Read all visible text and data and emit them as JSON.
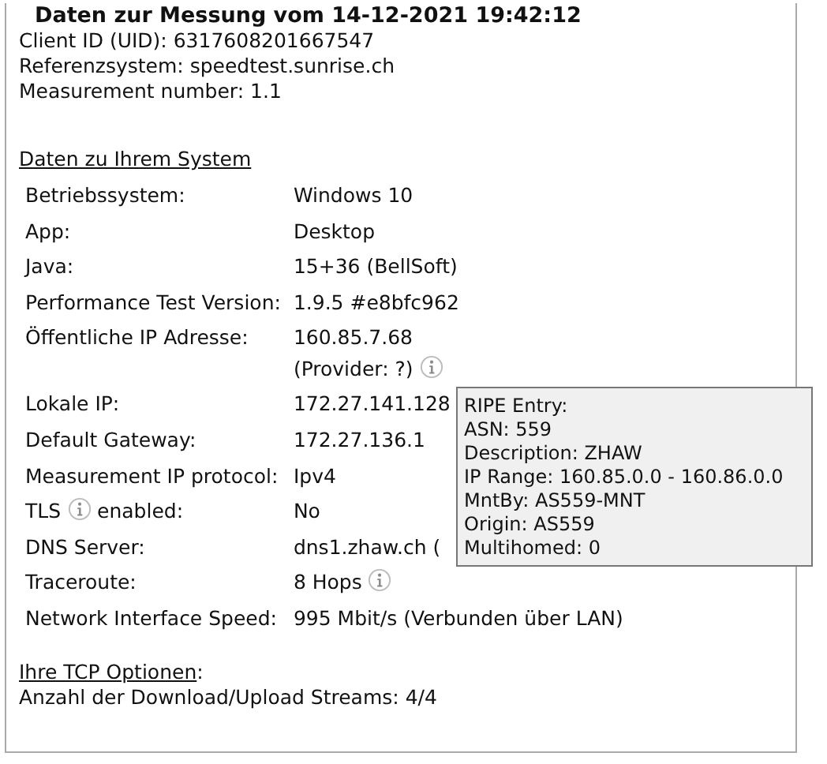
{
  "legend": "Daten zur Messung vom 14-12-2021 19:42:12",
  "header_lines": [
    "Client ID (UID): 6317608201667547",
    "Referenzsystem: speedtest.sunrise.ch",
    "Measurement number: 1.1"
  ],
  "system": {
    "heading": "Daten zu Ihrem System",
    "rows": [
      {
        "label": "Betriebssystem:",
        "label_info": false,
        "values": [
          "Windows 10"
        ],
        "value_info": false
      },
      {
        "label": "App:",
        "label_info": false,
        "values": [
          "Desktop"
        ],
        "value_info": false
      },
      {
        "label": "Java:",
        "label_info": false,
        "values": [
          "15+36 (BellSoft)"
        ],
        "value_info": false
      },
      {
        "label": "Performance Test Version:",
        "label_info": false,
        "values": [
          "1.9.5 #e8bfc962"
        ],
        "value_info": false
      },
      {
        "label": "Öffentliche IP Adresse:",
        "label_info": false,
        "values": [
          "160.85.7.68",
          "(Provider: ?)"
        ],
        "value_info": true
      },
      {
        "label": "Lokale IP:",
        "label_info": false,
        "values": [
          "172.27.141.128"
        ],
        "value_info": false
      },
      {
        "label": "Default Gateway:",
        "label_info": false,
        "values": [
          "172.27.136.1"
        ],
        "value_info": false
      },
      {
        "label": "Measurement IP protocol:",
        "label_info": false,
        "values": [
          "Ipv4"
        ],
        "value_info": false
      },
      {
        "label": "TLS",
        "label_suffix": "enabled:",
        "label_info": true,
        "values": [
          "No"
        ],
        "value_info": false
      },
      {
        "label": "DNS Server:",
        "label_info": false,
        "values": [
          "dns1.zhaw.ch ("
        ],
        "value_info": false
      },
      {
        "label": "Traceroute:",
        "label_info": false,
        "values": [
          "8 Hops"
        ],
        "value_info": true
      },
      {
        "label": "Network Interface Speed:",
        "label_info": false,
        "values": [
          "995 Mbit/s (Verbunden über LAN)"
        ],
        "value_info": false
      }
    ]
  },
  "tcp": {
    "heading": "Ihre TCP Optionen",
    "colon": ":",
    "line": "Anzahl der Download/Upload Streams: 4/4"
  },
  "tooltip": [
    "RIPE Entry:",
    "ASN: 559",
    "Description: ZHAW",
    "IP Range: 160.85.0.0 - 160.86.0.0",
    "MntBy: AS559-MNT",
    "Origin: AS559",
    "Multihomed: 0"
  ]
}
